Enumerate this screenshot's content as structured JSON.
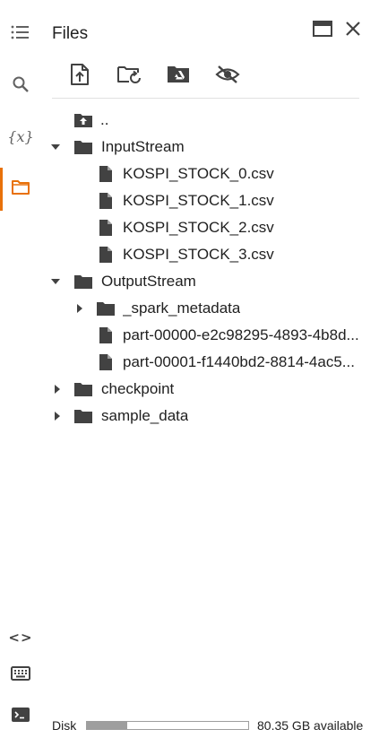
{
  "panel": {
    "title": "Files",
    "accent_color": "#e8710a"
  },
  "left_rail": {
    "items": [
      {
        "name": "table-of-contents",
        "icon": "list-icon"
      },
      {
        "name": "find",
        "icon": "search-icon"
      },
      {
        "name": "variables",
        "label": "{x}"
      },
      {
        "name": "files",
        "icon": "folder-icon",
        "active": true
      },
      {
        "name": "code-snippets",
        "label": "<>"
      },
      {
        "name": "command-palette",
        "icon": "keyboard-icon"
      },
      {
        "name": "terminal",
        "icon": "terminal-icon"
      }
    ]
  },
  "toolbar": {
    "buttons": [
      "upload-file",
      "refresh",
      "mount-drive",
      "toggle-hidden-files"
    ]
  },
  "tree": {
    "parent": "..",
    "items": [
      {
        "label": "InputStream",
        "type": "folder",
        "expanded": true
      },
      {
        "label": "KOSPI_STOCK_0.csv",
        "type": "file"
      },
      {
        "label": "KOSPI_STOCK_1.csv",
        "type": "file"
      },
      {
        "label": "KOSPI_STOCK_2.csv",
        "type": "file"
      },
      {
        "label": "KOSPI_STOCK_3.csv",
        "type": "file"
      },
      {
        "label": "OutputStream",
        "type": "folder",
        "expanded": true
      },
      {
        "label": "_spark_metadata",
        "type": "folder",
        "expanded": false
      },
      {
        "label": "part-00000-e2c98295-4893-4b8d...",
        "type": "file"
      },
      {
        "label": "part-00001-f1440bd2-8814-4ac5...",
        "type": "file"
      },
      {
        "label": "checkpoint",
        "type": "folder",
        "expanded": false
      },
      {
        "label": "sample_data",
        "type": "folder",
        "expanded": false
      }
    ]
  },
  "disk": {
    "label": "Disk",
    "used_fraction": 0.25,
    "available": "80.35 GB available"
  }
}
